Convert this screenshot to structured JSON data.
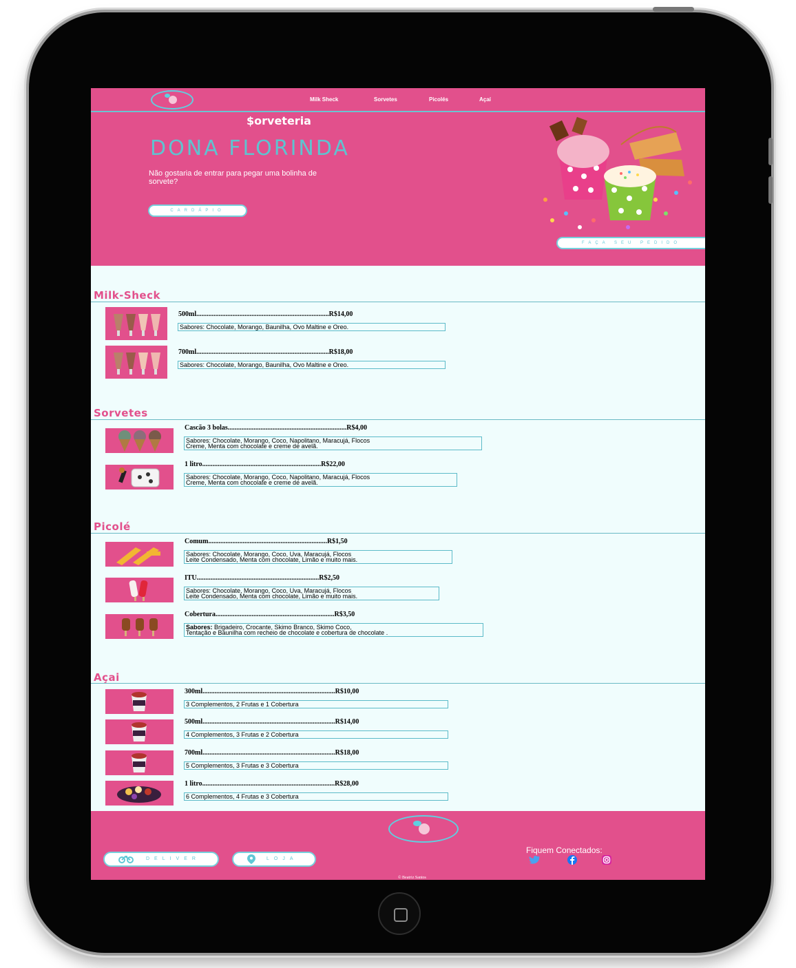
{
  "nav": {
    "items": [
      "Milk Sheck",
      "Sorvetes",
      "Picolés",
      "Açaí"
    ]
  },
  "hero": {
    "kicker": "$orveteria",
    "title": "DONA FLORINDA",
    "subtitle": "Não gostaria de entrar para pegar uma bolinha de sorvete?",
    "menu_button": "CARDÁPIO",
    "order_button": "FAÇA SEU PEDIDO"
  },
  "sections": {
    "milkshake": {
      "title": "Milk-Sheck",
      "items": [
        {
          "name": "500ml.............................................................................R$14,00",
          "desc": "Sabores: Chocolate, Morango, Baunilha, Ovo Maltine e Oreo."
        },
        {
          "name": "700ml.............................................................................R$18,00",
          "desc": "Sabores: Chocolate, Morango, Baunilha, Ovo Maltine e Oreo."
        }
      ]
    },
    "sorvetes": {
      "title": "Sorvetes",
      "items": [
        {
          "name": "Cascão 3 bolas.....................................................................R$4,00",
          "desc1": "Sabores: Chocolate, Morango, Coco, Napolitano, Maracujá, Flocos",
          "desc2": "Creme, Menta com chocolate e creme de avelã."
        },
        {
          "name": "1 litro.....................................................................R$22,00",
          "desc1": "Sabores: Chocolate, Morango, Coco, Napolitano, Maracujá, Flocos",
          "desc2": "Creme, Menta com chocolate e creme de avelã."
        }
      ]
    },
    "picole": {
      "title": "Picolé",
      "items": [
        {
          "name": "Comum.....................................................................R$1,50",
          "desc1": "Sabores: Chocolate, Morango, Coco, Uva, Maracujá, Flocos",
          "desc2": "Leite Condensado, Menta com chocolate, Limão e muito mais."
        },
        {
          "name": "ITU.......................................................................R$2,50",
          "desc1": "Sabores: Chocolate, Morango, Coco, Uva, Maracujá, Flocos",
          "desc2": "Leite Condensado, Menta com chocolate, Limão e muito mais."
        },
        {
          "name": "Cobertura.....................................................................R$3,50",
          "desc_bold": "Sabores:",
          "desc1": " Brigadeiro, Crocante, Skimo Branco, Skimo Coco,",
          "desc2": "Tentação e Baunilha com recheio de chocolate e cobertura de chocolate ."
        }
      ]
    },
    "acai": {
      "title": "Açai",
      "items": [
        {
          "name": "300ml.............................................................................R$10,00",
          "desc": "3 Complementos, 2 Frutas e 1 Cobertura"
        },
        {
          "name": "500ml.............................................................................R$14,00",
          "desc": "4 Complementos, 3 Frutas e 2 Cobertura"
        },
        {
          "name": "700ml.............................................................................R$18,00",
          "desc": "5 Complementos, 3 Frutas e 3 Cobertura"
        },
        {
          "name": "1 litro.............................................................................R$28,00",
          "desc": "6 Complementos, 4 Frutas e 3 Cobertura"
        }
      ]
    }
  },
  "footer": {
    "deliver_button": "DELIVER",
    "loja_button": "LOJA",
    "follow": "Fiquem Conectados:",
    "copyright": "© Beatriz Santos",
    "icons": [
      "bike-icon",
      "location-pin-icon",
      "twitter-icon",
      "facebook-icon",
      "instagram-icon"
    ]
  },
  "colors": {
    "brand_pink": "#e2508c",
    "accent_cyan": "#5fc3d0",
    "background": "#f0fdfd"
  }
}
